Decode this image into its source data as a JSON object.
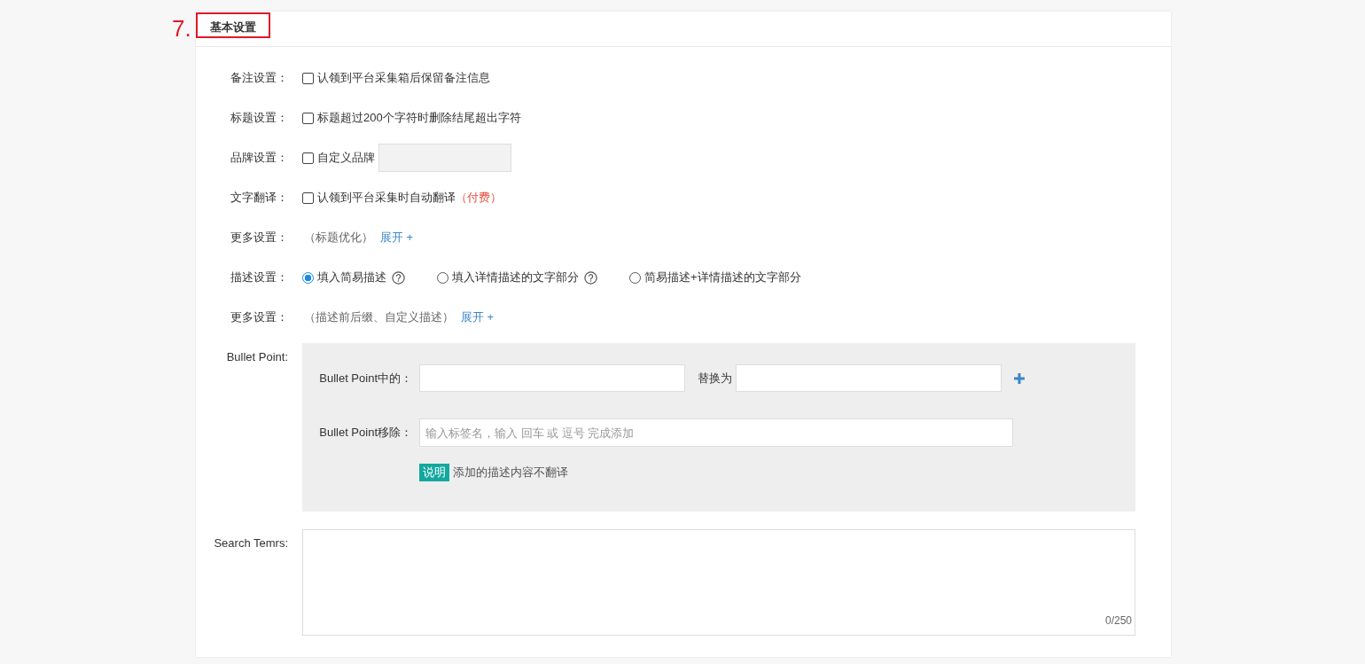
{
  "step_marker": "7.",
  "section": {
    "title": "基本设置"
  },
  "settings": [
    {
      "kind": "checkbox",
      "label": "备注设置：",
      "text": "认领到平台采集箱后保留备注信息",
      "checked": false
    },
    {
      "kind": "checkbox",
      "label": "标题设置：",
      "text": "标题超过200个字符时删除结尾超出字符",
      "checked": false
    },
    {
      "kind": "checkbox_input",
      "label": "品牌设置：",
      "text": "自定义品牌",
      "checked": false,
      "disabled": true
    },
    {
      "kind": "checkbox",
      "label": "文字翻译：",
      "text": "认领到平台采集时自动翻译",
      "note": "（付费）",
      "checked": false
    },
    {
      "kind": "more",
      "label": "更多设置：",
      "hint": "（标题优化）",
      "link": "展开 +"
    },
    {
      "kind": "radio",
      "label": "描述设置：",
      "options": [
        {
          "text": "填入简易描述",
          "help": true,
          "selected": true
        },
        {
          "text": "填入详情描述的文字部分",
          "help": true,
          "selected": false
        },
        {
          "text": "简易描述+详情描述的文字部分",
          "help": false,
          "selected": false
        }
      ]
    },
    {
      "kind": "more",
      "label": "更多设置：",
      "hint": "（描述前后缀、自定义描述）",
      "link": "展开 +"
    }
  ],
  "bullet_point": {
    "label": "Bullet Point:",
    "replace_label": "Bullet Point中的：",
    "replace_with_label": "替换为",
    "remove_label": "Bullet Point移除：",
    "remove_placeholder": "输入标签名，输入 回车 或 逗号 完成添加",
    "note_tag": "说明",
    "note_text": "添加的描述内容不翻译"
  },
  "search_terms": {
    "label": "Search Temrs:",
    "counter": "0/250"
  }
}
